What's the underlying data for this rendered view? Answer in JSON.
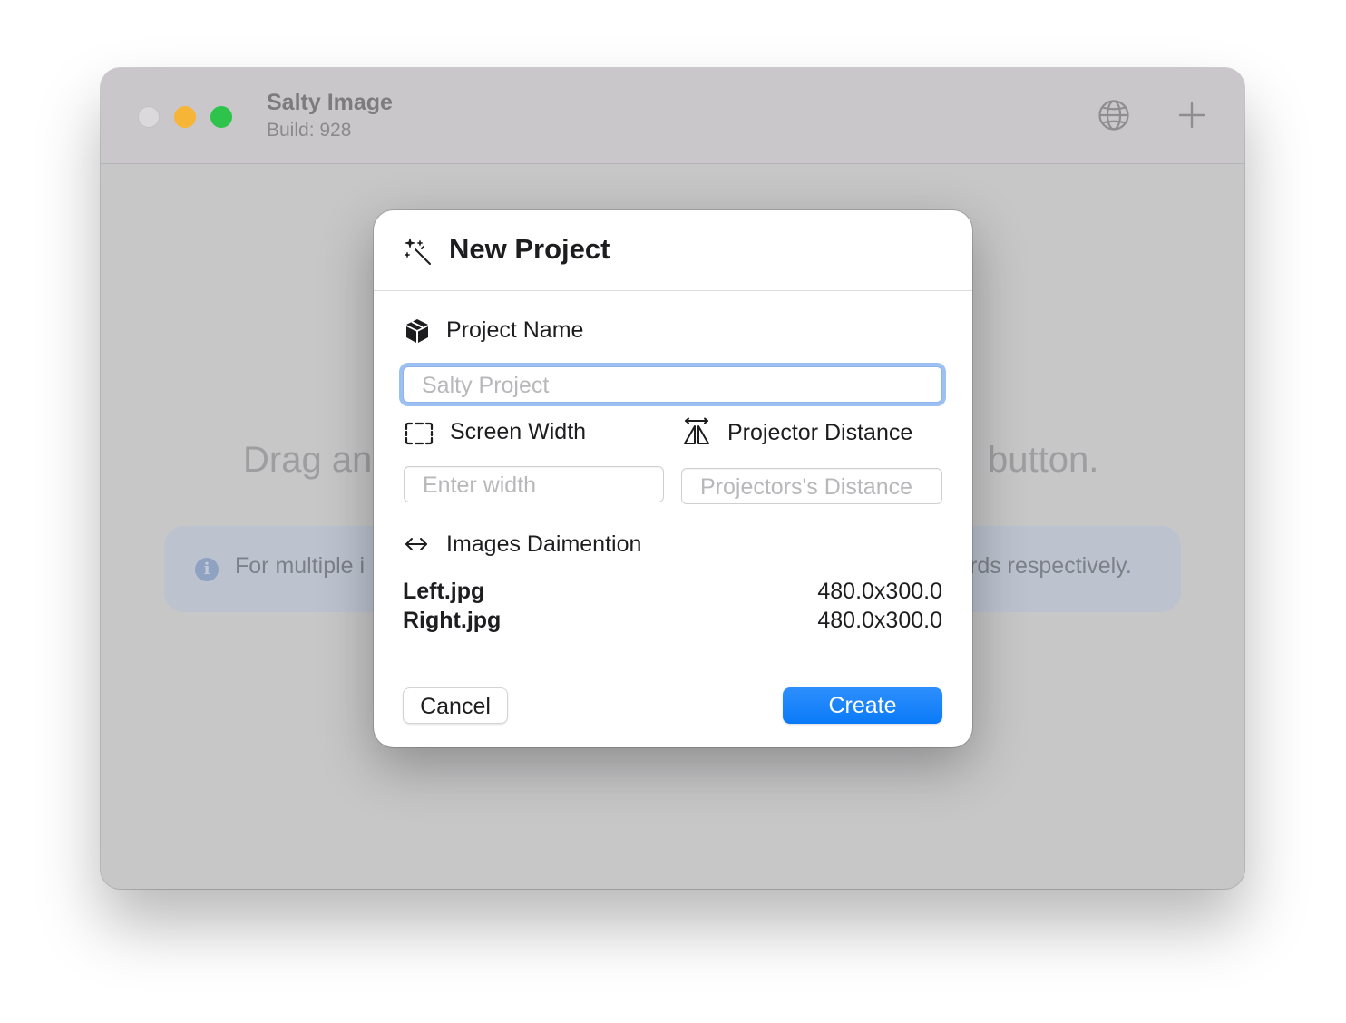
{
  "window": {
    "app_title": "Salty Image",
    "build_label": "Build: 928",
    "toolbar_icons": [
      "globe-icon",
      "plus-icon"
    ]
  },
  "background": {
    "hint_left": "Drag and",
    "hint_right": "button.",
    "info_left": "For multiple i",
    "info_right": "rds respectively."
  },
  "dialog": {
    "title": "New Project",
    "title_icon": "magic-wand-icon",
    "project_name": {
      "label": "Project Name",
      "icon": "cube-icon",
      "placeholder": "Salty Project",
      "value": ""
    },
    "screen_width": {
      "label": "Screen Width",
      "icon": "screen-frame-icon",
      "placeholder": "Enter width",
      "value": ""
    },
    "projector_distance": {
      "label": "Projector Distance",
      "icon": "projector-distance-icon",
      "placeholder": "Projectors's Distance",
      "value": ""
    },
    "images": {
      "label": "Images Daimention",
      "icon": "left-right-arrow-icon",
      "files": [
        {
          "name": "Left.jpg",
          "dimension": "480.0x300.0"
        },
        {
          "name": "Right.jpg",
          "dimension": "480.0x300.0"
        }
      ]
    },
    "buttons": {
      "cancel": "Cancel",
      "create": "Create"
    }
  },
  "colors": {
    "accent": "#0a7af8",
    "focus_ring": "#9dc0f2",
    "traffic_close": "#dcd9dc",
    "traffic_minimize": "#f7b538",
    "traffic_maximize": "#2ec44c"
  }
}
